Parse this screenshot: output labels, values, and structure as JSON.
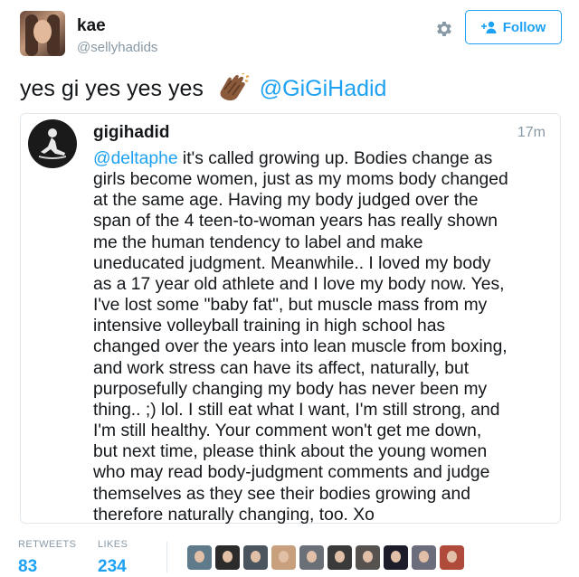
{
  "user": {
    "name": "kae",
    "handle": "@sellyhadids"
  },
  "actions": {
    "follow_label": "Follow",
    "settings_icon": "gear-icon",
    "follow_icon": "add-person-icon"
  },
  "tweet": {
    "text_prefix": "yes gi yes yes yes",
    "emoji": "clapping-hands",
    "mention": "@GiGiHadid"
  },
  "quoted": {
    "name": "gigihadid",
    "time": "17m",
    "lines": [
      {
        "mention": "@deltaphe",
        "text": " it's called growing up. Bodies change as"
      },
      {
        "text": "girls become women, just as my moms body changed"
      },
      {
        "text": "at the same age. Having my body judged over the"
      },
      {
        "text": "span of the 4 teen-to-woman years has really shown"
      },
      {
        "text": "me the human tendency to label and make"
      },
      {
        "text": "uneducated judgment. Meanwhile.. I loved my body"
      },
      {
        "text": "as a 17 year old athlete and I love my body now. Yes,"
      },
      {
        "text": "I've lost some \"baby fat\", but muscle mass from my"
      },
      {
        "text": "intensive volleyball training in high school has"
      },
      {
        "text": "changed over the years into lean muscle from boxing,"
      },
      {
        "text": "and work stress can have its affect, naturally, but"
      },
      {
        "text": "purposefully changing my body has never been my"
      },
      {
        "text": "thing.. ;) lol. I still eat what I want, I'm still strong, and"
      },
      {
        "text": "I'm still healthy. Your comment won't get me down,"
      },
      {
        "text": "but next time, please think about the young women"
      },
      {
        "text": "who may read body-judgment comments and judge"
      },
      {
        "text": "themselves as they see their bodies growing and"
      },
      {
        "text": "therefore naturally changing, too. Xo"
      }
    ]
  },
  "stats": {
    "retweets_label": "RETWEETS",
    "retweets": "83",
    "likes_label": "LIKES",
    "likes": "234"
  },
  "likers": [
    {
      "color": "#5f7a8a"
    },
    {
      "color": "#2b2b2b"
    },
    {
      "color": "#4b5560"
    },
    {
      "color": "#c8a07e"
    },
    {
      "color": "#6a6f78"
    },
    {
      "color": "#3a3a3a"
    },
    {
      "color": "#55524f"
    },
    {
      "color": "#1c1c2a"
    },
    {
      "color": "#6b6d7c"
    },
    {
      "color": "#b04a3a"
    }
  ],
  "colors": {
    "accent": "#1da1f2",
    "muted": "#8899a6",
    "text": "#14171a",
    "border": "#e1e8ed"
  }
}
